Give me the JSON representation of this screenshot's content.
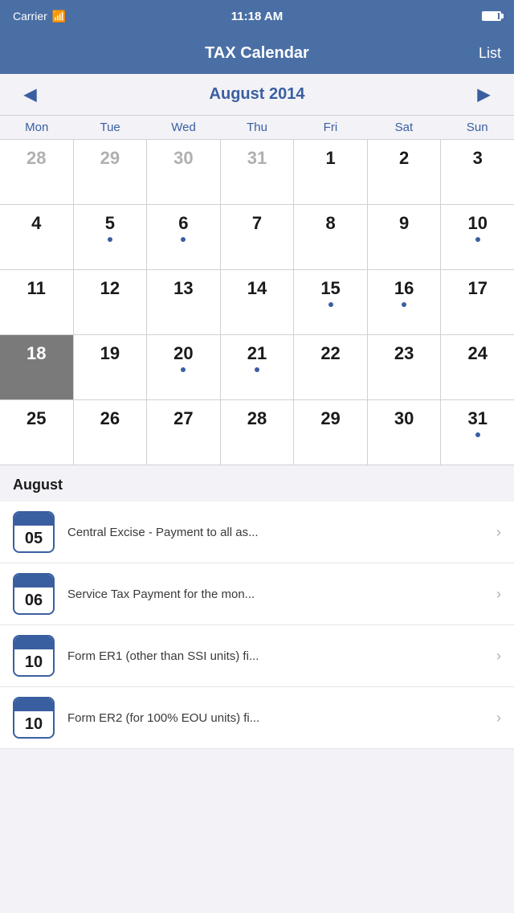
{
  "statusBar": {
    "carrier": "Carrier",
    "time": "11:18 AM"
  },
  "navBar": {
    "title": "TAX Calendar",
    "listButton": "List"
  },
  "calendar": {
    "monthTitle": "August 2014",
    "prevArrow": "◀",
    "nextArrow": "▶",
    "dayHeaders": [
      "Mon",
      "Tue",
      "Wed",
      "Thu",
      "Fri",
      "Sat",
      "Sun"
    ],
    "weeks": [
      [
        {
          "day": "28",
          "otherMonth": true,
          "dot": false,
          "today": false
        },
        {
          "day": "29",
          "otherMonth": true,
          "dot": false,
          "today": false
        },
        {
          "day": "30",
          "otherMonth": true,
          "dot": false,
          "today": false
        },
        {
          "day": "31",
          "otherMonth": true,
          "dot": false,
          "today": false
        },
        {
          "day": "1",
          "otherMonth": false,
          "dot": false,
          "today": false
        },
        {
          "day": "2",
          "otherMonth": false,
          "dot": false,
          "today": false
        },
        {
          "day": "3",
          "otherMonth": false,
          "dot": false,
          "today": false
        }
      ],
      [
        {
          "day": "4",
          "otherMonth": false,
          "dot": false,
          "today": false
        },
        {
          "day": "5",
          "otherMonth": false,
          "dot": true,
          "today": false
        },
        {
          "day": "6",
          "otherMonth": false,
          "dot": true,
          "today": false
        },
        {
          "day": "7",
          "otherMonth": false,
          "dot": false,
          "today": false
        },
        {
          "day": "8",
          "otherMonth": false,
          "dot": false,
          "today": false
        },
        {
          "day": "9",
          "otherMonth": false,
          "dot": false,
          "today": false
        },
        {
          "day": "10",
          "otherMonth": false,
          "dot": true,
          "today": false
        }
      ],
      [
        {
          "day": "11",
          "otherMonth": false,
          "dot": false,
          "today": false
        },
        {
          "day": "12",
          "otherMonth": false,
          "dot": false,
          "today": false
        },
        {
          "day": "13",
          "otherMonth": false,
          "dot": false,
          "today": false
        },
        {
          "day": "14",
          "otherMonth": false,
          "dot": false,
          "today": false
        },
        {
          "day": "15",
          "otherMonth": false,
          "dot": true,
          "today": false
        },
        {
          "day": "16",
          "otherMonth": false,
          "dot": true,
          "today": false
        },
        {
          "day": "17",
          "otherMonth": false,
          "dot": false,
          "today": false
        }
      ],
      [
        {
          "day": "18",
          "otherMonth": false,
          "dot": false,
          "today": true
        },
        {
          "day": "19",
          "otherMonth": false,
          "dot": false,
          "today": false
        },
        {
          "day": "20",
          "otherMonth": false,
          "dot": true,
          "today": false
        },
        {
          "day": "21",
          "otherMonth": false,
          "dot": true,
          "today": false
        },
        {
          "day": "22",
          "otherMonth": false,
          "dot": false,
          "today": false
        },
        {
          "day": "23",
          "otherMonth": false,
          "dot": false,
          "today": false
        },
        {
          "day": "24",
          "otherMonth": false,
          "dot": false,
          "today": false
        }
      ],
      [
        {
          "day": "25",
          "otherMonth": false,
          "dot": false,
          "today": false
        },
        {
          "day": "26",
          "otherMonth": false,
          "dot": false,
          "today": false
        },
        {
          "day": "27",
          "otherMonth": false,
          "dot": false,
          "today": false
        },
        {
          "day": "28",
          "otherMonth": false,
          "dot": false,
          "today": false
        },
        {
          "day": "29",
          "otherMonth": false,
          "dot": false,
          "today": false
        },
        {
          "day": "30",
          "otherMonth": false,
          "dot": false,
          "today": false
        },
        {
          "day": "31",
          "otherMonth": false,
          "dot": true,
          "today": false
        }
      ]
    ]
  },
  "events": {
    "monthLabel": "August",
    "items": [
      {
        "date": "05",
        "title": "Central Excise - Payment to all as..."
      },
      {
        "date": "06",
        "title": "Service Tax Payment for the mon..."
      },
      {
        "date": "10",
        "title": "Form ER1 (other than SSI units) fi..."
      },
      {
        "date": "10",
        "title": "Form ER2 (for 100% EOU units) fi..."
      }
    ]
  }
}
